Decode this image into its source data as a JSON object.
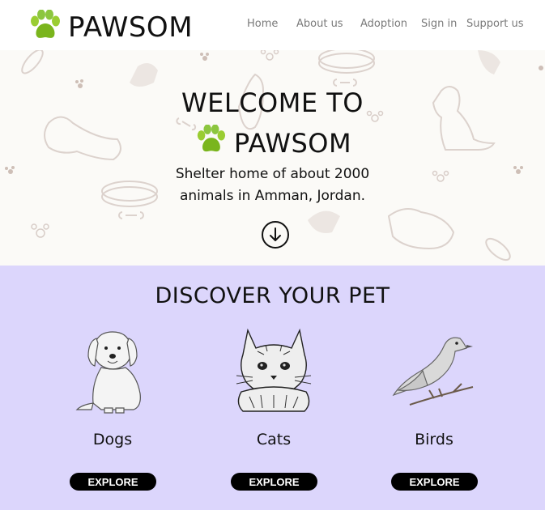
{
  "brand": {
    "name": "PAWSOM",
    "logo_icon": "paw-icon",
    "logo_color": "#8cc63f"
  },
  "nav": {
    "items": [
      {
        "label": "Home"
      },
      {
        "label": "About us"
      },
      {
        "label": "Adoption"
      },
      {
        "label": "Sign in"
      },
      {
        "label": "Support us"
      }
    ]
  },
  "hero": {
    "title_line1": "WELCOME TO",
    "title_brand": "PAWSOM",
    "subtitle_line1": "Shelter home of about 2000",
    "subtitle_line2": "animals in Amman, Jordan.",
    "scroll_icon": "arrow-down-circle-icon",
    "background_color": "#fbfaf7"
  },
  "discover": {
    "title": "DISCOVER YOUR PET",
    "background_color": "#dcd6fc",
    "pets": [
      {
        "label": "Dogs",
        "button": "EXPLORE",
        "icon": "dog-illustration"
      },
      {
        "label": "Cats",
        "button": "EXPLORE",
        "icon": "cat-illustration"
      },
      {
        "label": "Birds",
        "button": "EXPLORE",
        "icon": "bird-illustration"
      }
    ]
  }
}
